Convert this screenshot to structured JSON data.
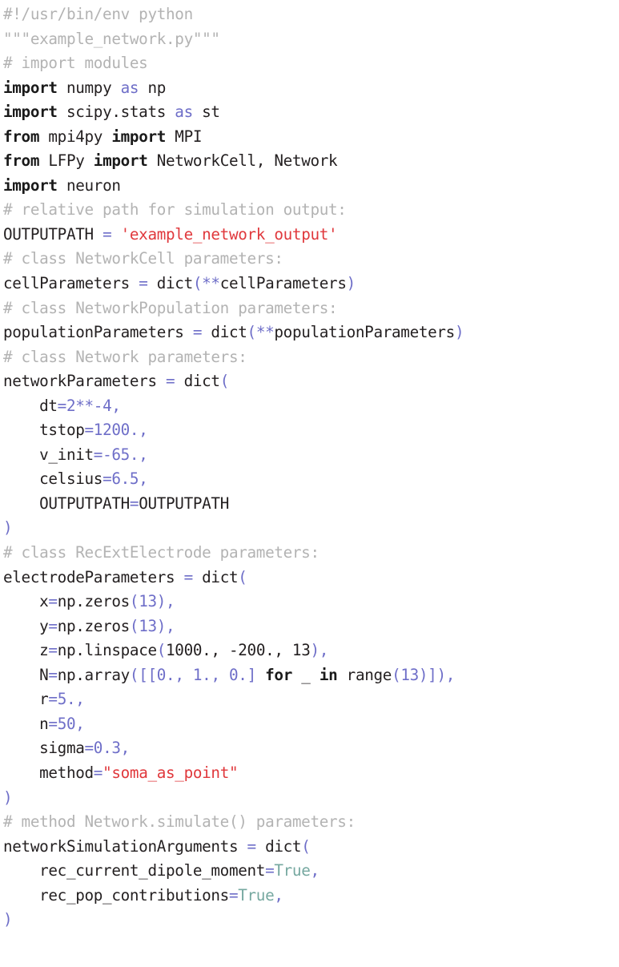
{
  "document": {
    "type": "source-code-listing",
    "language": "python",
    "filename": "example_network.py",
    "background_color": "#ffffff",
    "colors": {
      "plain": "#231f20",
      "comment": "#b3b3b3",
      "string": "#e0383c",
      "keyword": "#1a1a1a",
      "operator": "#6e6ec8",
      "number": "#6e6ec8",
      "punctuation": "#6e6ec8",
      "constant": "#76a8a0"
    }
  },
  "code": {
    "lines": [
      {
        "n": 1,
        "tokens": [
          {
            "t": "comment",
            "s": "#!/usr/bin/env python"
          }
        ]
      },
      {
        "n": 2,
        "tokens": [
          {
            "t": "comment",
            "s": "\"\"\"example_network.py\"\"\""
          }
        ]
      },
      {
        "n": 3,
        "tokens": [
          {
            "t": "comment",
            "s": "# import modules"
          }
        ]
      },
      {
        "n": 4,
        "tokens": [
          {
            "t": "keyword",
            "s": "import"
          },
          {
            "t": "plain",
            "s": " numpy "
          },
          {
            "t": "op",
            "s": "as"
          },
          {
            "t": "plain",
            "s": " np"
          }
        ]
      },
      {
        "n": 5,
        "tokens": [
          {
            "t": "keyword",
            "s": "import"
          },
          {
            "t": "plain",
            "s": " scipy.stats "
          },
          {
            "t": "op",
            "s": "as"
          },
          {
            "t": "plain",
            "s": " st"
          }
        ]
      },
      {
        "n": 6,
        "tokens": [
          {
            "t": "keyword",
            "s": "from"
          },
          {
            "t": "plain",
            "s": " mpi4py "
          },
          {
            "t": "keyword",
            "s": "import"
          },
          {
            "t": "plain",
            "s": " MPI"
          }
        ]
      },
      {
        "n": 7,
        "tokens": [
          {
            "t": "keyword",
            "s": "from"
          },
          {
            "t": "plain",
            "s": " LFPy "
          },
          {
            "t": "keyword",
            "s": "import"
          },
          {
            "t": "plain",
            "s": " NetworkCell, Network"
          }
        ]
      },
      {
        "n": 8,
        "tokens": [
          {
            "t": "keyword",
            "s": "import"
          },
          {
            "t": "plain",
            "s": " neuron"
          }
        ]
      },
      {
        "n": 9,
        "tokens": [
          {
            "t": "comment",
            "s": "# relative path for simulation output:"
          }
        ]
      },
      {
        "n": 10,
        "tokens": [
          {
            "t": "plain",
            "s": "OUTPUTPATH "
          },
          {
            "t": "op",
            "s": "="
          },
          {
            "t": "plain",
            "s": " "
          },
          {
            "t": "string",
            "s": "'example_network_output'"
          }
        ]
      },
      {
        "n": 11,
        "tokens": [
          {
            "t": "comment",
            "s": "# class NetworkCell parameters:"
          }
        ]
      },
      {
        "n": 12,
        "tokens": [
          {
            "t": "plain",
            "s": "cellParameters "
          },
          {
            "t": "op",
            "s": "="
          },
          {
            "t": "plain",
            "s": " dict"
          },
          {
            "t": "punct",
            "s": "("
          },
          {
            "t": "op",
            "s": "**"
          },
          {
            "t": "plain",
            "s": "cellParameters"
          },
          {
            "t": "punct",
            "s": ")"
          }
        ]
      },
      {
        "n": 13,
        "tokens": [
          {
            "t": "comment",
            "s": "# class NetworkPopulation parameters:"
          }
        ]
      },
      {
        "n": 14,
        "tokens": [
          {
            "t": "plain",
            "s": "populationParameters "
          },
          {
            "t": "op",
            "s": "="
          },
          {
            "t": "plain",
            "s": " dict"
          },
          {
            "t": "punct",
            "s": "("
          },
          {
            "t": "op",
            "s": "**"
          },
          {
            "t": "plain",
            "s": "populationParameters"
          },
          {
            "t": "punct",
            "s": ")"
          }
        ]
      },
      {
        "n": 15,
        "tokens": [
          {
            "t": "comment",
            "s": "# class Network parameters:"
          }
        ]
      },
      {
        "n": 16,
        "tokens": [
          {
            "t": "plain",
            "s": "networkParameters "
          },
          {
            "t": "op",
            "s": "="
          },
          {
            "t": "plain",
            "s": " dict"
          },
          {
            "t": "punct",
            "s": "("
          }
        ]
      },
      {
        "n": 17,
        "tokens": [
          {
            "t": "plain",
            "s": "    dt"
          },
          {
            "t": "op",
            "s": "="
          },
          {
            "t": "num",
            "s": "2"
          },
          {
            "t": "op",
            "s": "**"
          },
          {
            "t": "num",
            "s": "-4"
          },
          {
            "t": "punct",
            "s": ","
          }
        ]
      },
      {
        "n": 18,
        "tokens": [
          {
            "t": "plain",
            "s": "    tstop"
          },
          {
            "t": "op",
            "s": "="
          },
          {
            "t": "num",
            "s": "1200."
          },
          {
            "t": "punct",
            "s": ","
          }
        ]
      },
      {
        "n": 19,
        "tokens": [
          {
            "t": "plain",
            "s": "    v_init"
          },
          {
            "t": "op",
            "s": "="
          },
          {
            "t": "num",
            "s": "-65."
          },
          {
            "t": "punct",
            "s": ","
          }
        ]
      },
      {
        "n": 20,
        "tokens": [
          {
            "t": "plain",
            "s": "    celsius"
          },
          {
            "t": "op",
            "s": "="
          },
          {
            "t": "num",
            "s": "6.5"
          },
          {
            "t": "punct",
            "s": ","
          }
        ]
      },
      {
        "n": 21,
        "tokens": [
          {
            "t": "plain",
            "s": "    OUTPUTPATH"
          },
          {
            "t": "op",
            "s": "="
          },
          {
            "t": "plain",
            "s": "OUTPUTPATH"
          }
        ]
      },
      {
        "n": 22,
        "tokens": [
          {
            "t": "punct",
            "s": ")"
          }
        ]
      },
      {
        "n": 23,
        "tokens": [
          {
            "t": "comment",
            "s": "# class RecExtElectrode parameters:"
          }
        ]
      },
      {
        "n": 24,
        "tokens": [
          {
            "t": "plain",
            "s": "electrodeParameters "
          },
          {
            "t": "op",
            "s": "="
          },
          {
            "t": "plain",
            "s": " dict"
          },
          {
            "t": "punct",
            "s": "("
          }
        ]
      },
      {
        "n": 25,
        "tokens": [
          {
            "t": "plain",
            "s": "    x"
          },
          {
            "t": "op",
            "s": "="
          },
          {
            "t": "plain",
            "s": "np.zeros"
          },
          {
            "t": "punct",
            "s": "("
          },
          {
            "t": "num",
            "s": "13"
          },
          {
            "t": "punct",
            "s": "),"
          }
        ]
      },
      {
        "n": 26,
        "tokens": [
          {
            "t": "plain",
            "s": "    y"
          },
          {
            "t": "op",
            "s": "="
          },
          {
            "t": "plain",
            "s": "np.zeros"
          },
          {
            "t": "punct",
            "s": "("
          },
          {
            "t": "num",
            "s": "13"
          },
          {
            "t": "punct",
            "s": "),"
          }
        ]
      },
      {
        "n": 27,
        "tokens": [
          {
            "t": "plain",
            "s": "    z"
          },
          {
            "t": "op",
            "s": "="
          },
          {
            "t": "plain",
            "s": "np.linspace"
          },
          {
            "t": "punct",
            "s": "("
          },
          {
            "t": "plain",
            "s": "1000., -200., 13"
          },
          {
            "t": "punct",
            "s": "),"
          }
        ]
      },
      {
        "n": 28,
        "tokens": [
          {
            "t": "plain",
            "s": "    N"
          },
          {
            "t": "op",
            "s": "="
          },
          {
            "t": "plain",
            "s": "np.array"
          },
          {
            "t": "punct",
            "s": "(["
          },
          {
            "t": "punct",
            "s": "["
          },
          {
            "t": "num",
            "s": "0."
          },
          {
            "t": "punct",
            "s": ", "
          },
          {
            "t": "num",
            "s": "1."
          },
          {
            "t": "punct",
            "s": ", "
          },
          {
            "t": "num",
            "s": "0."
          },
          {
            "t": "punct",
            "s": "]"
          },
          {
            "t": "plain",
            "s": " "
          },
          {
            "t": "keyword",
            "s": "for"
          },
          {
            "t": "plain",
            "s": " _ "
          },
          {
            "t": "keyword",
            "s": "in"
          },
          {
            "t": "plain",
            "s": " range"
          },
          {
            "t": "punct",
            "s": "("
          },
          {
            "t": "num",
            "s": "13"
          },
          {
            "t": "punct",
            "s": ")]),"
          }
        ]
      },
      {
        "n": 29,
        "tokens": [
          {
            "t": "plain",
            "s": "    r"
          },
          {
            "t": "op",
            "s": "="
          },
          {
            "t": "num",
            "s": "5."
          },
          {
            "t": "punct",
            "s": ","
          }
        ]
      },
      {
        "n": 30,
        "tokens": [
          {
            "t": "plain",
            "s": "    n"
          },
          {
            "t": "op",
            "s": "="
          },
          {
            "t": "num",
            "s": "50"
          },
          {
            "t": "punct",
            "s": ","
          }
        ]
      },
      {
        "n": 31,
        "tokens": [
          {
            "t": "plain",
            "s": "    sigma"
          },
          {
            "t": "op",
            "s": "="
          },
          {
            "t": "num",
            "s": "0.3"
          },
          {
            "t": "punct",
            "s": ","
          }
        ]
      },
      {
        "n": 32,
        "tokens": [
          {
            "t": "plain",
            "s": "    method"
          },
          {
            "t": "op",
            "s": "="
          },
          {
            "t": "string",
            "s": "\"soma_as_point\""
          }
        ]
      },
      {
        "n": 33,
        "tokens": [
          {
            "t": "punct",
            "s": ")"
          }
        ]
      },
      {
        "n": 34,
        "tokens": [
          {
            "t": "comment",
            "s": "# method Network.simulate() parameters:"
          }
        ]
      },
      {
        "n": 35,
        "tokens": [
          {
            "t": "plain",
            "s": "networkSimulationArguments "
          },
          {
            "t": "op",
            "s": "="
          },
          {
            "t": "plain",
            "s": " dict"
          },
          {
            "t": "punct",
            "s": "("
          }
        ]
      },
      {
        "n": 36,
        "tokens": [
          {
            "t": "plain",
            "s": "    rec_current_dipole_moment"
          },
          {
            "t": "op",
            "s": "="
          },
          {
            "t": "const",
            "s": "True"
          },
          {
            "t": "punct",
            "s": ","
          }
        ]
      },
      {
        "n": 37,
        "tokens": [
          {
            "t": "plain",
            "s": "    rec_pop_contributions"
          },
          {
            "t": "op",
            "s": "="
          },
          {
            "t": "const",
            "s": "True"
          },
          {
            "t": "punct",
            "s": ","
          }
        ]
      },
      {
        "n": 38,
        "tokens": [
          {
            "t": "punct",
            "s": ")"
          }
        ]
      }
    ],
    "plain_text": [
      "#!/usr/bin/env python",
      "\"\"\"example_network.py\"\"\"",
      "# import modules",
      "import numpy as np",
      "import scipy.stats as st",
      "from mpi4py import MPI",
      "from LFPy import NetworkCell, Network",
      "import neuron",
      "# relative path for simulation output:",
      "OUTPUTPATH = 'example_network_output'",
      "# class NetworkCell parameters:",
      "cellParameters = dict(**cellParameters)",
      "# class NetworkPopulation parameters:",
      "populationParameters = dict(**populationParameters)",
      "# class Network parameters:",
      "networkParameters = dict(",
      "    dt=2**-4,",
      "    tstop=1200.,",
      "    v_init=-65.,",
      "    celsius=6.5,",
      "    OUTPUTPATH=OUTPUTPATH",
      ")",
      "# class RecExtElectrode parameters:",
      "electrodeParameters = dict(",
      "    x=np.zeros(13),",
      "    y=np.zeros(13),",
      "    z=np.linspace(1000., -200., 13),",
      "    N=np.array([[0., 1., 0.] for _ in range(13)]),",
      "    r=5.,",
      "    n=50,",
      "    sigma=0.3,",
      "    method=\"soma_as_point\"",
      ")",
      "# method Network.simulate() parameters:",
      "networkSimulationArguments = dict(",
      "    rec_current_dipole_moment=True,",
      "    rec_pop_contributions=True,",
      ")"
    ]
  }
}
